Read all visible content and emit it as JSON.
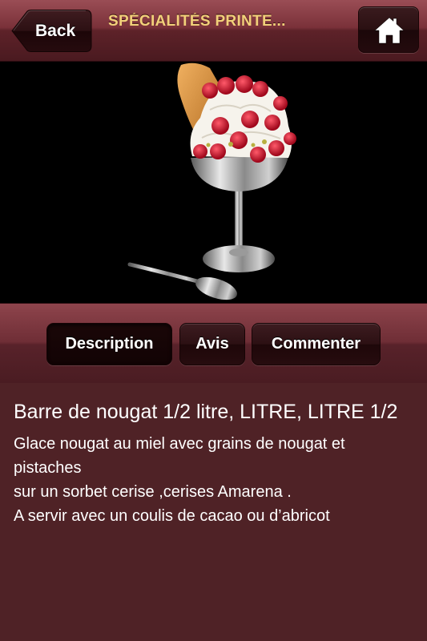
{
  "navbar": {
    "back_label": "Back",
    "title": "SPÉCIALITÉS PRINTE...",
    "home_icon": "home-icon"
  },
  "photo": {
    "subject": "ice-cream-coupe-image"
  },
  "tabs": [
    {
      "label": "Description",
      "active": true
    },
    {
      "label": "Avis",
      "active": false
    },
    {
      "label": "Commenter",
      "active": false
    }
  ],
  "product": {
    "title": "Barre de nougat 1/2 litre, LITRE, LITRE 1/2",
    "description_lines": [
      "Glace nougat au miel avec grains de nougat et",
      "pistaches",
      "sur un sorbet cerise ,cerises Amarena .",
      "A servir avec un coulis de cacao ou d’abricot"
    ]
  },
  "colors": {
    "background": "#4f2226",
    "title_accent": "#f2d07a",
    "text": "#ffffff"
  }
}
